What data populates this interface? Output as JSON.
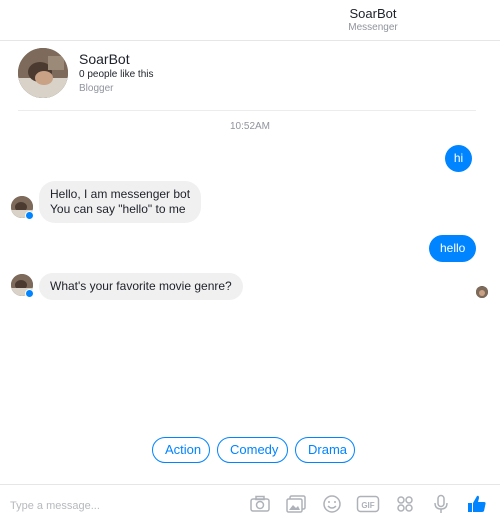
{
  "header": {
    "title": "SoarBot",
    "subtitle": "Messenger"
  },
  "profile": {
    "name": "SoarBot",
    "likes": "0 people like this",
    "category": "Blogger"
  },
  "timestamp": "10:52AM",
  "messages": [
    {
      "from": "user",
      "text": "hi"
    },
    {
      "from": "bot",
      "lines": [
        "Hello, I am messenger bot",
        "You can say \"hello\" to me"
      ]
    },
    {
      "from": "user",
      "text": "hello"
    },
    {
      "from": "bot",
      "text": "What's your favorite movie genre?"
    }
  ],
  "quick_replies": [
    "Action",
    "Comedy",
    "Drama"
  ],
  "composer": {
    "placeholder": "Type a message...",
    "icons": [
      "camera-icon",
      "photo-gallery-icon",
      "emoji-icon",
      "gif-icon",
      "apps-icon",
      "microphone-icon",
      "like-thumb-icon"
    ]
  },
  "colors": {
    "accent": "#0084ff",
    "incoming_bubble": "#f1f0f0",
    "muted_text": "#90949c"
  }
}
